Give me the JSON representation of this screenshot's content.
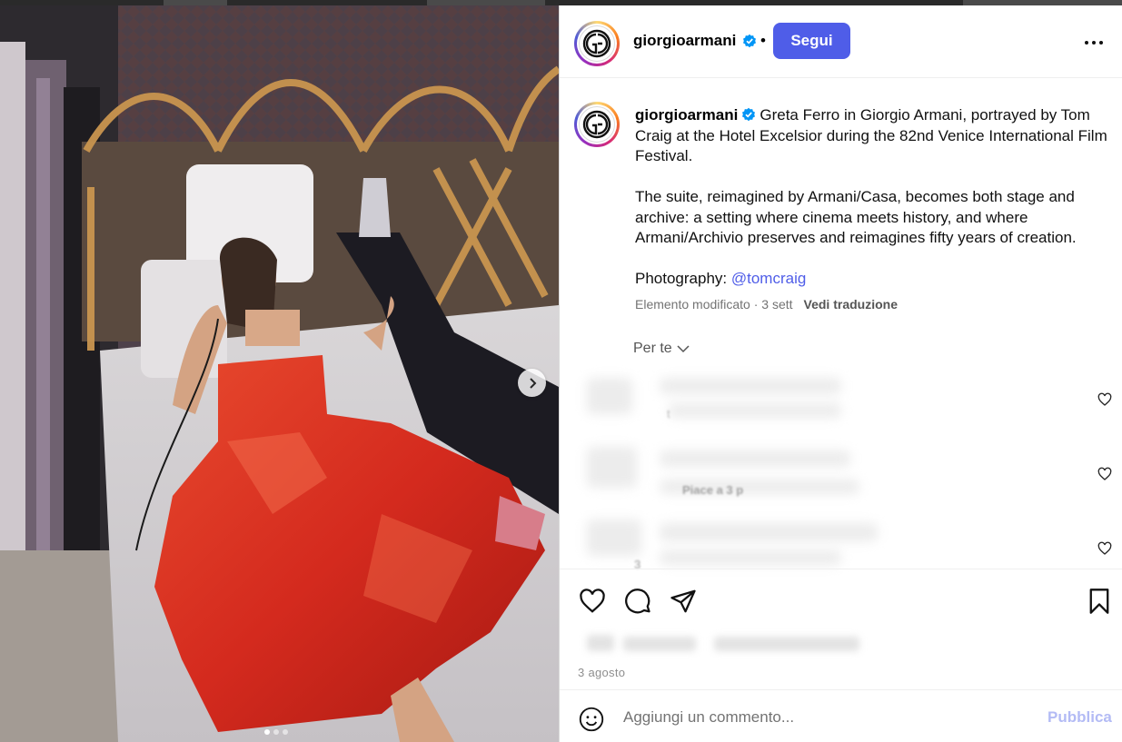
{
  "post": {
    "username": "giorgioarmani",
    "separator": "•",
    "follow_label": "Segui",
    "caption_line1": "Greta Ferro in Giorgio Armani, portrayed by Tom Craig at the Hotel Excelsior during the 82nd Venice International Film Festival.",
    "caption_line2": "The suite, reimagined by Armani/Casa, becomes both stage and archive: a setting where cinema meets history, and where Armani/Archivio preserves and reimagines fifty years of creation.",
    "caption_photo_prefix": "Photography: ",
    "caption_mention": "@tomcraig",
    "edited_label": "Elemento modificato · 3 sett",
    "translate_label": "Vedi traduzione",
    "sort_label": "Per te",
    "date_label": "3 agosto"
  },
  "comments": [
    {
      "fragment": "t"
    },
    {
      "fragment": "Piace a 3 p"
    },
    {
      "fragment": "3"
    }
  ],
  "composer": {
    "placeholder": "Aggiungi un commento...",
    "publish_label": "Pubblica"
  },
  "carousel": {
    "total": 3,
    "current": 1
  },
  "colors": {
    "accent": "#4f5de8",
    "verified": "#0095f6",
    "dress": "#d42a1e"
  },
  "icons": [
    "verified-badge-icon",
    "more-options-icon",
    "chevron-down-icon",
    "heart-icon",
    "comment-icon",
    "share-icon",
    "bookmark-icon",
    "emoji-icon",
    "chevron-right-icon"
  ]
}
